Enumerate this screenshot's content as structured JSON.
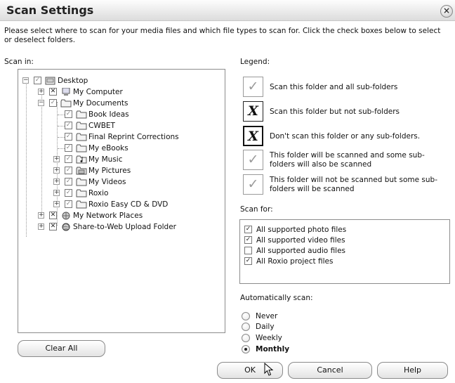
{
  "window": {
    "title": "Scan Settings",
    "close_glyph": "×",
    "description": "Please select where to scan for your media files and which file types to scan for. Click the check boxes below to select or deselect folders."
  },
  "scan_in": {
    "label": "Scan in:",
    "tree": [
      {
        "name": "Desktop",
        "expander": "−",
        "check": "✓",
        "icon": "desktop-icon"
      },
      {
        "name": "My Computer",
        "expander": "+",
        "check": "✕",
        "icon": "computer-icon"
      },
      {
        "name": "My Documents",
        "expander": "−",
        "check": "✓",
        "icon": "folder-icon"
      },
      {
        "name": "Book Ideas",
        "expander": "",
        "check": "✓",
        "icon": "folder-icon"
      },
      {
        "name": "CWBET",
        "expander": "",
        "check": "✓",
        "icon": "folder-icon"
      },
      {
        "name": "Final Reprint Corrections",
        "expander": "",
        "check": "✓",
        "icon": "folder-icon"
      },
      {
        "name": "My eBooks",
        "expander": "",
        "check": "✓",
        "icon": "folder-icon"
      },
      {
        "name": "My Music",
        "expander": "+",
        "check": "✓",
        "icon": "music-folder-icon"
      },
      {
        "name": "My Pictures",
        "expander": "+",
        "check": "✓",
        "icon": "pictures-folder-icon"
      },
      {
        "name": "My Videos",
        "expander": "+",
        "check": "✓",
        "icon": "folder-icon"
      },
      {
        "name": "Roxio",
        "expander": "+",
        "check": "✓",
        "icon": "folder-icon"
      },
      {
        "name": "Roxio Easy CD & DVD",
        "expander": "+",
        "check": "✓",
        "icon": "folder-icon"
      },
      {
        "name": "My Network Places",
        "expander": "+",
        "check": "✕",
        "icon": "network-icon"
      },
      {
        "name": "Share-to-Web Upload Folder",
        "expander": "+",
        "check": "✕",
        "icon": "share-web-icon"
      }
    ],
    "clear_all": "Clear All"
  },
  "legend": {
    "label": "Legend:",
    "items": [
      {
        "glyph": "✓",
        "text": "Scan this folder and all sub-folders"
      },
      {
        "glyph": "X",
        "text": "Scan this folder but not sub-folders"
      },
      {
        "glyph": "X",
        "text": "Don't scan this folder or any sub-folders."
      },
      {
        "glyph": "✓",
        "text": "This folder will be scanned and some sub-folders will also be scanned"
      },
      {
        "glyph": "✓",
        "text": "This folder will not be scanned but some sub-folders will be scanned"
      }
    ]
  },
  "scan_for": {
    "label": "Scan for:",
    "items": [
      {
        "text": "All supported photo files",
        "checked": true,
        "mark": "✓"
      },
      {
        "text": "All supported video files",
        "checked": true,
        "mark": "✓"
      },
      {
        "text": "All supported audio files",
        "checked": false,
        "mark": ""
      },
      {
        "text": "All Roxio project files",
        "checked": true,
        "mark": "✓"
      }
    ]
  },
  "auto_scan": {
    "label": "Automatically scan:",
    "options": [
      {
        "text": "Never",
        "selected": false
      },
      {
        "text": "Daily",
        "selected": false
      },
      {
        "text": "Weekly",
        "selected": false
      },
      {
        "text": "Monthly",
        "selected": true
      }
    ]
  },
  "buttons": {
    "ok": "OK",
    "cancel": "Cancel",
    "help": "Help"
  },
  "colors": {
    "accent_check": "#9a9a9a",
    "border": "#8c8c8c",
    "title_bar": "#dcdcdc"
  }
}
